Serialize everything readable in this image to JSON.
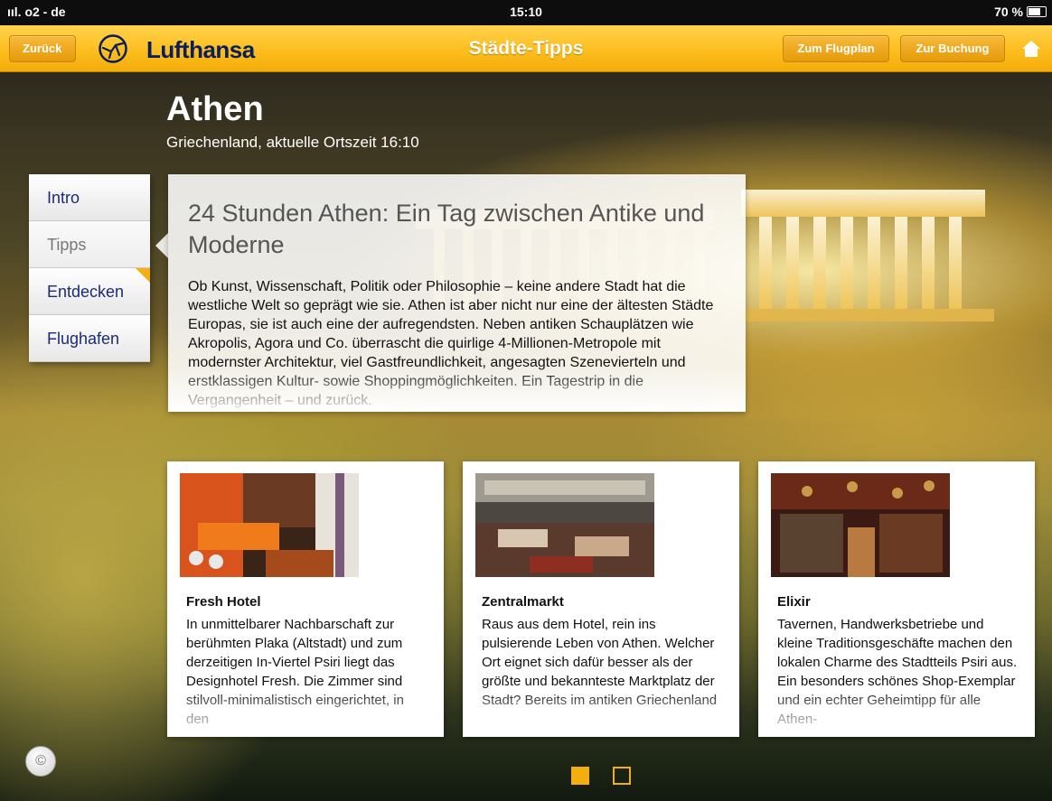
{
  "status_bar": {
    "carrier": "ııl. o2 - de",
    "time": "15:10",
    "battery": "70 %"
  },
  "header": {
    "back_label": "Zurück",
    "brand": "Lufthansa",
    "title": "Städte-Tipps",
    "flugplan_label": "Zum Flugplan",
    "buchung_label": "Zur Buchung"
  },
  "city": {
    "name": "Athen",
    "subtitle": "Griechenland, aktuelle Ortszeit 16:10"
  },
  "menu": [
    {
      "label": "Intro"
    },
    {
      "label": "Tipps"
    },
    {
      "label": "Entdecken"
    },
    {
      "label": "Flughafen"
    }
  ],
  "intro": {
    "title": "24 Stunden Athen: Ein Tag zwischen Antike und Moderne",
    "body": "Ob Kunst, Wissenschaft, Politik oder Philosophie – keine andere Stadt hat die westliche Welt so geprägt wie sie. Athen ist aber nicht nur eine der ältesten Städte Europas, sie ist auch eine der aufregendsten. Neben antiken Schauplätzen wie Akropolis, Agora und Co. überrascht die quirlige 4-Millionen-Metropole mit modernster Architektur, viel Gastfreundlichkeit, angesagten Szenevierteln und erstklassigen Kultur- sowie Shoppingmöglichkeiten. Ein Tagestrip in die Vergangenheit – und zurück."
  },
  "cards": [
    {
      "title": "Fresh Hotel",
      "text": "In unmittelbarer Nachbarschaft zur berühmten Plaka (Altstadt) und zum derzeitigen In-Viertel Psiri liegt das Designhotel Fresh. Die Zimmer sind stilvoll-minimalistisch eingerichtet, in den"
    },
    {
      "title": "Zentralmarkt",
      "text": "Raus aus dem Hotel, rein ins pulsierende Leben von Athen. Welcher Ort eignet sich dafür besser als der größte und bekannteste Marktplatz der Stadt? Bereits im antiken Griechenland"
    },
    {
      "title": "Elixir",
      "text": "Tavernen, Handwerksbetriebe und kleine Traditionsgeschäfte machen den lokalen Charme des Stadtteils Psiri aus. Ein besonders schönes Shop-Exemplar und ein echter Geheimtipp für alle Athen-"
    }
  ],
  "copyright_symbol": "©",
  "pagination": {
    "current": 1,
    "total": 2
  },
  "colors": {
    "brand_yellow": "#f9b91a",
    "brand_navy": "#0a1d5c",
    "menu_text": "#1a2a7a"
  }
}
